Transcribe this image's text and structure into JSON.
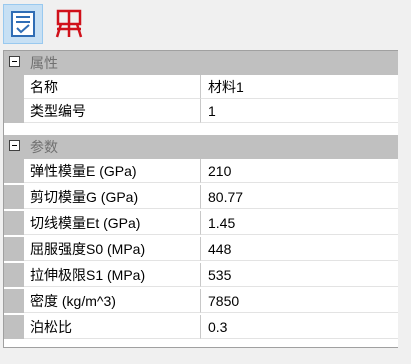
{
  "toolbar": {
    "buttons": [
      {
        "icon": "property-view-icon",
        "selected": true
      },
      {
        "icon": "red-structure-icon",
        "selected": false
      }
    ]
  },
  "grid": {
    "categories": [
      {
        "label": "属性",
        "expanded": true,
        "properties": [
          {
            "name": "名称",
            "value": "材料1"
          },
          {
            "name": "类型编号",
            "value": "1"
          }
        ]
      },
      {
        "label": "参数",
        "expanded": true,
        "properties": [
          {
            "name": "弹性模量E (GPa)",
            "value": "210"
          },
          {
            "name": "剪切模量G (GPa)",
            "value": "80.77"
          },
          {
            "name": "切线模量Et (GPa)",
            "value": "1.45"
          },
          {
            "name": "屈服强度S0 (MPa)",
            "value": "448"
          },
          {
            "name": "拉伸极限S1 (MPa)",
            "value": "535"
          },
          {
            "name": "密度 (kg/m^3)",
            "value": "7850"
          },
          {
            "name": "泊松比",
            "value": "0.3"
          }
        ]
      }
    ]
  },
  "colors": {
    "category_band": "#c0c0c0",
    "selected_button_bg": "#c7e0f4",
    "icon_blue": "#2f6db5",
    "icon_red": "#d0101a"
  }
}
